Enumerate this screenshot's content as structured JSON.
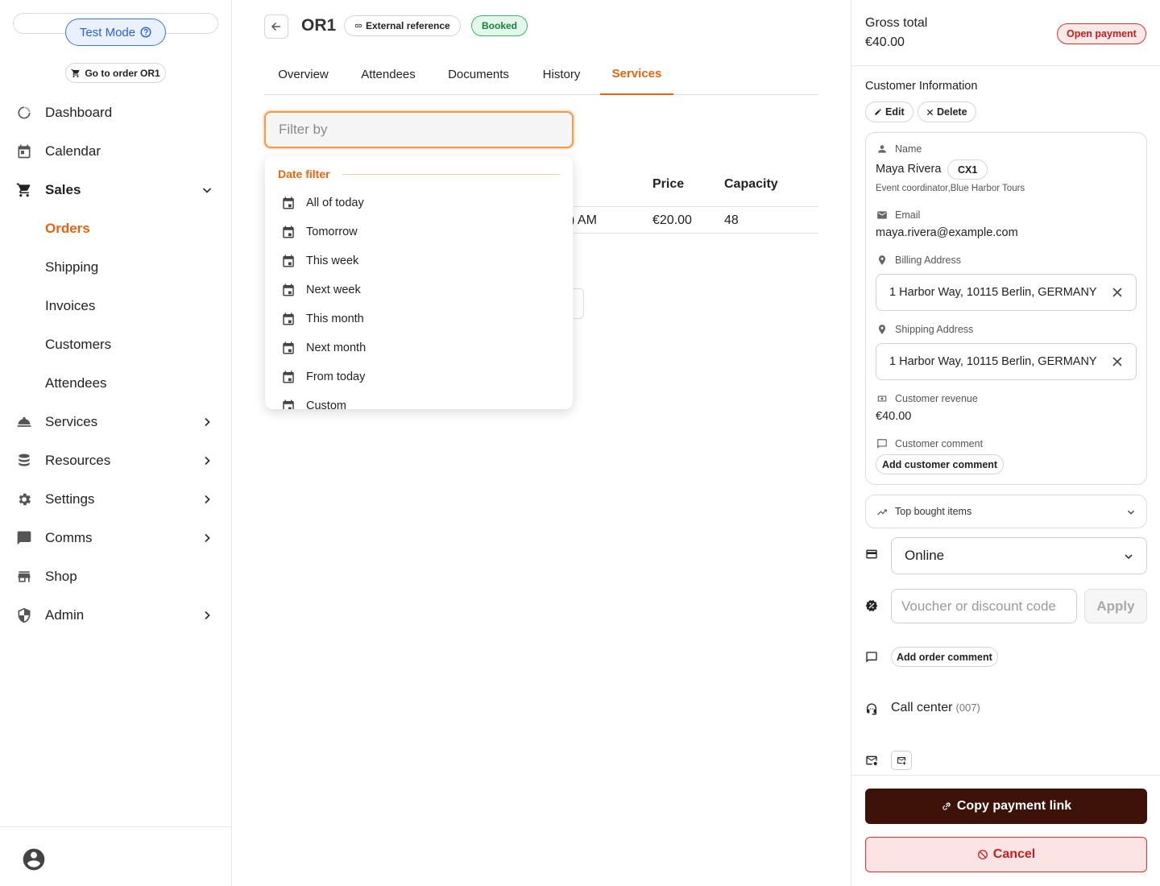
{
  "sidebar": {
    "test_mode_label": "Test Mode",
    "goto_order_label": "Go to order OR1",
    "nav": {
      "dashboard": "Dashboard",
      "calendar": "Calendar",
      "sales": "Sales",
      "orders": "Orders",
      "shipping": "Shipping",
      "invoices": "Invoices",
      "customers": "Customers",
      "attendees": "Attendees",
      "services": "Services",
      "resources": "Resources",
      "settings": "Settings",
      "comms": "Comms",
      "shop": "Shop",
      "admin": "Admin"
    }
  },
  "header": {
    "order_id": "OR1",
    "external_reference_label": "External reference",
    "status_badge": "Booked"
  },
  "tabs": {
    "overview": "Overview",
    "attendees": "Attendees",
    "documents": "Documents",
    "history": "History",
    "services": "Services",
    "active": "Services"
  },
  "filter": {
    "placeholder": "Filter by",
    "dropdown_title": "Date filter",
    "options": [
      "All of today",
      "Tomorrow",
      "This week",
      "Next week",
      "This month",
      "Next month",
      "From today",
      "Custom"
    ]
  },
  "table": {
    "headers": {
      "price": "Price",
      "capacity": "Capacity"
    },
    "rows": [
      {
        "time_fragment": ") AM",
        "price": "€20.00",
        "capacity": "48"
      }
    ]
  },
  "summary": {
    "gross_total_label": "Gross total",
    "gross_total_value": "€40.00",
    "payment_status": "Open payment"
  },
  "customer": {
    "section_title": "Customer Information",
    "edit_label": "Edit",
    "delete_label": "Delete",
    "name_label": "Name",
    "name": "Maya Rivera",
    "customer_id": "CX1",
    "subtitle": "Event coordinator,Blue Harbor Tours",
    "email_label": "Email",
    "email": "maya.rivera@example.com",
    "billing_label": "Billing Address",
    "billing_address": "1 Harbor Way, 10115 Berlin, GERMANY",
    "shipping_label": "Shipping Address",
    "shipping_address": "1 Harbor Way, 10115 Berlin, GERMANY",
    "revenue_label": "Customer revenue",
    "revenue": "€40.00",
    "comment_label": "Customer comment",
    "add_comment_label": "Add customer comment"
  },
  "order_panel": {
    "top_items_label": "Top bought items",
    "payment_method": "Online",
    "voucher_placeholder": "Voucher or discount code",
    "apply_label": "Apply",
    "add_order_comment_label": "Add order comment",
    "channel": "Call center",
    "channel_code": "(007)",
    "copy_payment_link_label": "Copy payment link",
    "cancel_label": "Cancel"
  },
  "colors": {
    "accent": "#e8650f",
    "primary_dark": "#3d1208",
    "danger": "#e03131",
    "success": "#17803f",
    "info": "#3d72e0"
  }
}
